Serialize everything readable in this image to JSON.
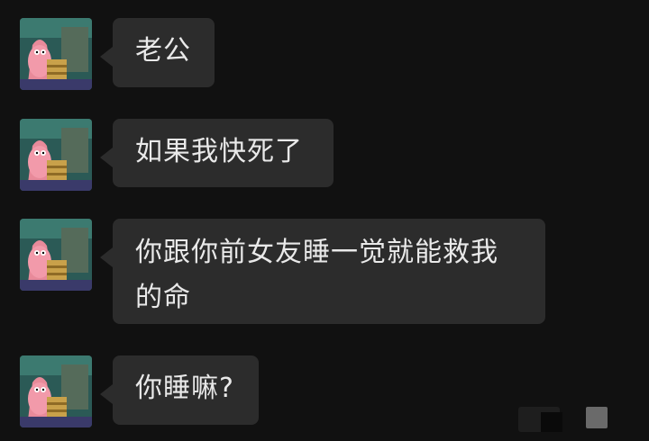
{
  "messages": [
    {
      "sender": "other",
      "text": "老公"
    },
    {
      "sender": "other",
      "text": "如果我快死了"
    },
    {
      "sender": "other",
      "text": "你跟你前女友睡一觉就能救我的命"
    },
    {
      "sender": "other",
      "text": "你睡嘛?"
    }
  ],
  "avatar_icon": "patrick-star-avatar",
  "colors": {
    "background": "#111111",
    "bubble": "#2c2c2c",
    "text": "#e9e9e9"
  }
}
